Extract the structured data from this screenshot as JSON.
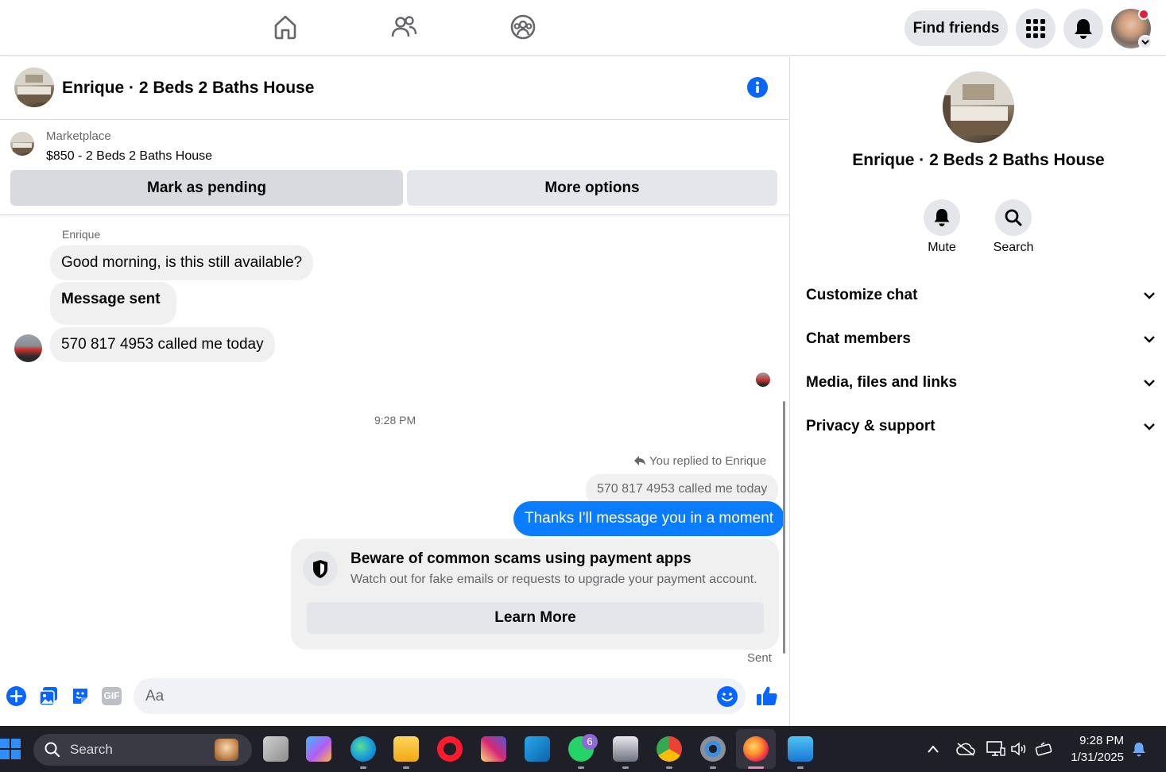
{
  "topbar": {
    "find_friends_label": "Find friends"
  },
  "chat": {
    "title": "Enrique · 2 Beds 2 Baths House"
  },
  "marketplace": {
    "label": "Marketplace",
    "listing": "$850 - 2 Beds 2 Baths House",
    "mark_pending_label": "Mark as pending",
    "more_options_label": "More options"
  },
  "messages": {
    "sender_name": "Enrique",
    "msg1": "Good morning, is this still available?",
    "msg2": "Message sent",
    "msg3": "570 817 4953 called me today",
    "timestamp": "9:28 PM",
    "replied_label": "You replied to Enrique",
    "quoted": "570 817 4953 called me today",
    "reply": "Thanks I'll message you in a moment",
    "status": "Sent"
  },
  "scam_notice": {
    "title": "Beware of common scams using payment apps",
    "body": "Watch out for fake emails or requests to upgrade your payment account.",
    "button_label": "Learn More"
  },
  "composer": {
    "placeholder": "Aa"
  },
  "right_panel": {
    "title": "Enrique · 2 Beds 2 Baths House",
    "mute_label": "Mute",
    "search_label": "Search",
    "sections": [
      "Customize chat",
      "Chat members",
      "Media, files and links",
      "Privacy & support"
    ]
  },
  "taskbar": {
    "search_label": "Search",
    "whatsapp_badge": "6",
    "time": "9:28 PM",
    "date": "1/31/2025"
  },
  "colors": {
    "accent": "#0866ff",
    "outgoing_bubble": "#0a7cff",
    "notification_red": "#e41e3f"
  }
}
